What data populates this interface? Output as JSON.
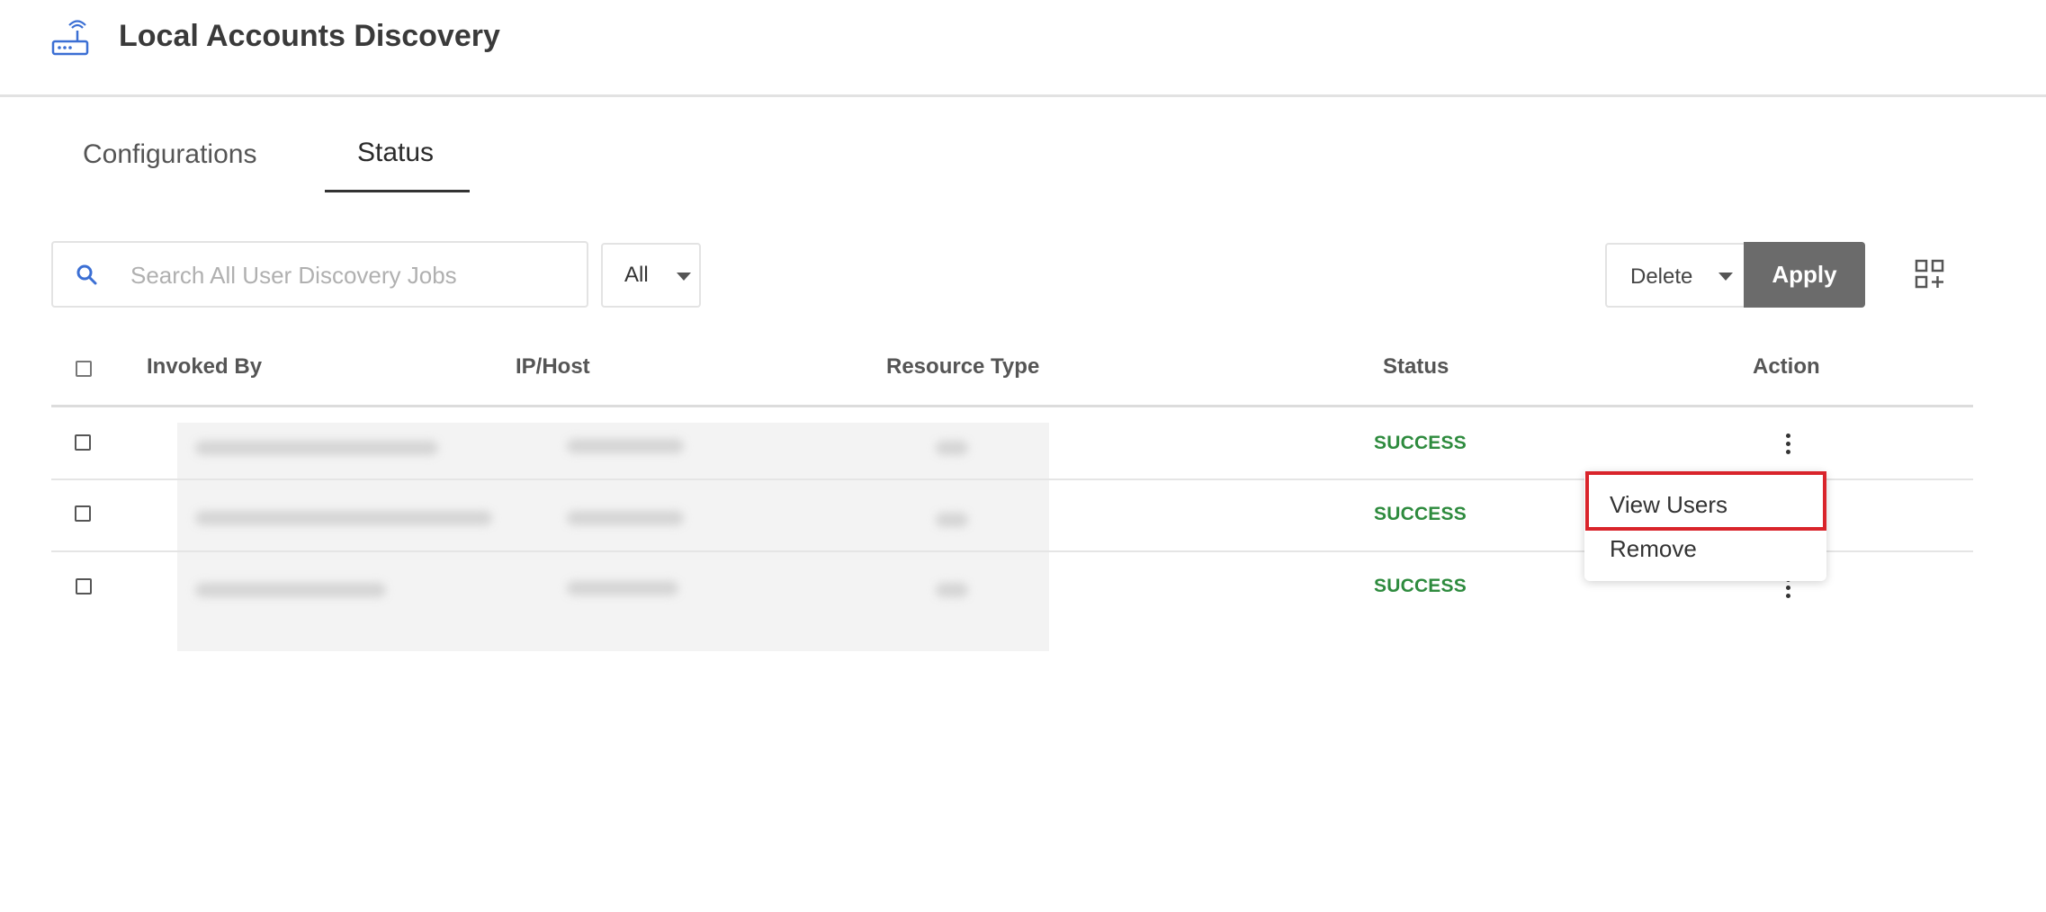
{
  "header": {
    "title": "Local Accounts Discovery",
    "icon": "router-icon"
  },
  "tabs": [
    {
      "label": "Configurations",
      "active": false
    },
    {
      "label": "Status",
      "active": true
    }
  ],
  "toolbar": {
    "search_placeholder": "Search All User Discovery Jobs",
    "filter_value": "All",
    "bulk_action_value": "Delete",
    "apply_label": "Apply",
    "layout_icon": "grid-add-icon"
  },
  "table": {
    "columns": [
      "Invoked By",
      "IP/Host",
      "Resource Type",
      "Status",
      "Action"
    ],
    "rows": [
      {
        "status": "SUCCESS"
      },
      {
        "status": "SUCCESS"
      },
      {
        "status": "SUCCESS"
      }
    ]
  },
  "context_menu": {
    "items": [
      "View Users",
      "Remove"
    ],
    "highlight_color": "#d9242b"
  },
  "colors": {
    "accent": "#3b6fd4",
    "success": "#2e8b3e",
    "apply_button": "#6b6b6b"
  }
}
